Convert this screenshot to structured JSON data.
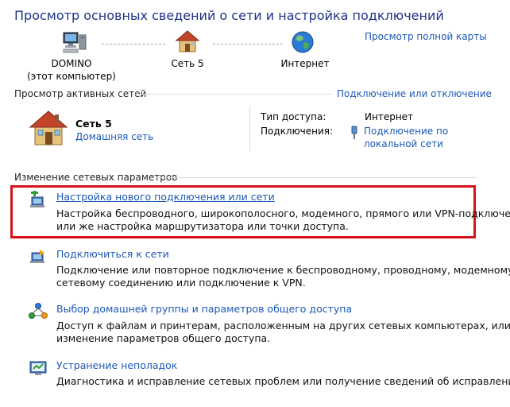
{
  "header": {
    "title": "Просмотр основных сведений о сети и настройка подключений",
    "full_map_link": "Просмотр полной карты"
  },
  "network_map": {
    "computer_name": "DOMINO",
    "computer_sub": "(этот компьютер)",
    "network_name": "Сеть 5",
    "internet_label": "Интернет"
  },
  "active_networks": {
    "label": "Просмотр активных сетей",
    "connect_link": "Подключение или отключение",
    "network_name": "Сеть 5",
    "network_type_link": "Домашняя сеть",
    "access_type_label": "Тип доступа:",
    "access_type_value": "Интернет",
    "connections_label": "Подключения:",
    "connection_link_line1": "Подключение по",
    "connection_link_line2": "локальной сети"
  },
  "change_settings": {
    "label": "Изменение сетевых параметров",
    "tasks": [
      {
        "title": "Настройка нового подключения или сети",
        "desc_line1": "Настройка беспроводного, широкополосного, модемного, прямого или VPN-подключения",
        "desc_line2": "или же настройка маршрутизатора или точки доступа."
      },
      {
        "title": "Подключиться к сети",
        "desc_line1": "Подключение или повторное подключение к беспроводному, проводному, модемному",
        "desc_line2": "сетевому соединению или подключение к VPN."
      },
      {
        "title": "Выбор домашней группы и параметров общего доступа",
        "desc_line1": "Доступ к файлам и принтерам, расположенным на других сетевых компьютерах, или",
        "desc_line2": "изменение параметров общего доступа."
      },
      {
        "title": "Устранение неполадок",
        "desc_line1": "Диагностика и исправление сетевых проблем или получение сведений об исправлении."
      }
    ]
  }
}
